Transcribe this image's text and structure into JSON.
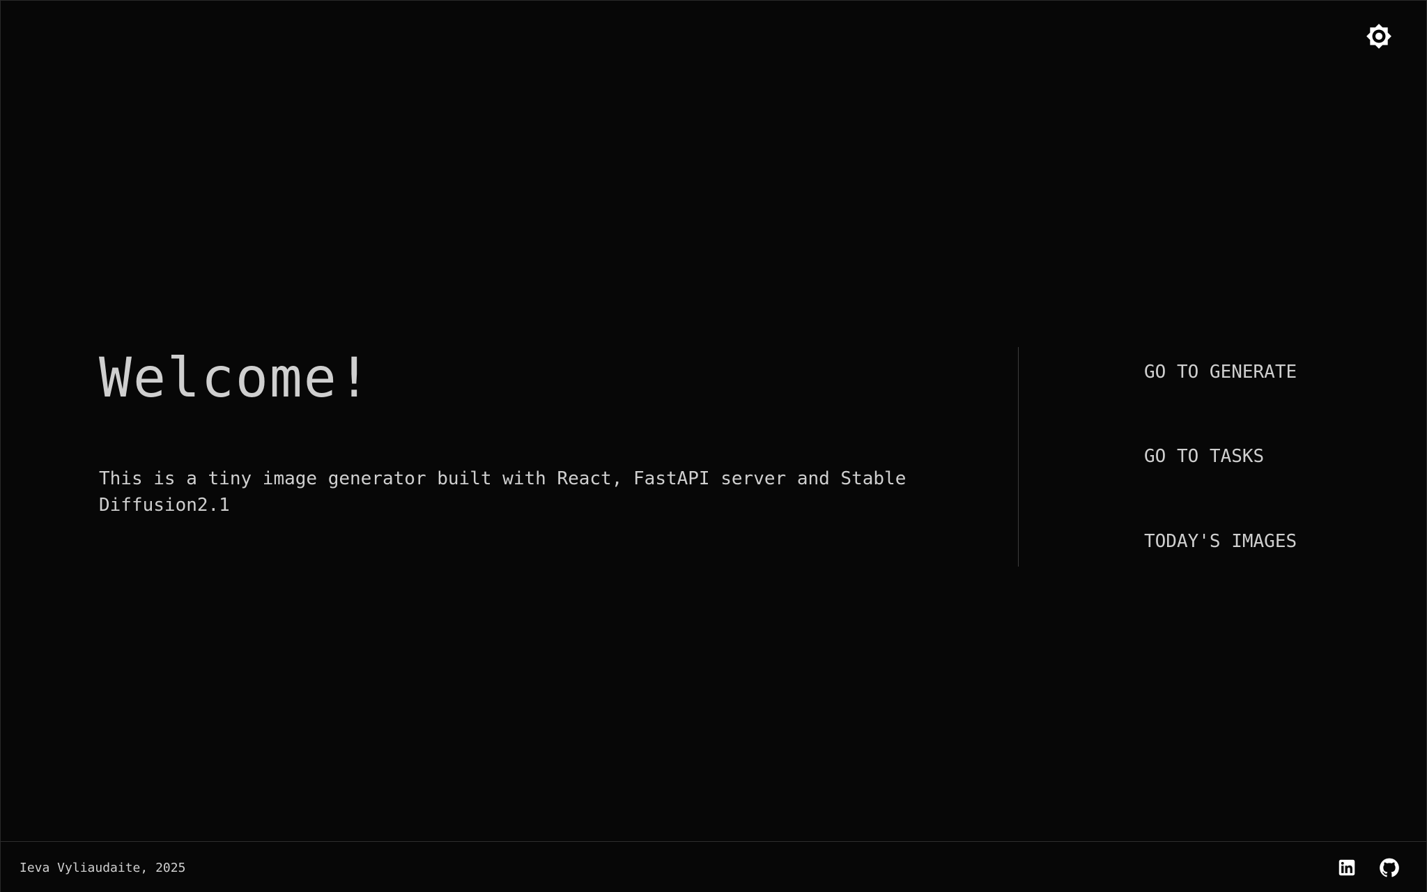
{
  "header": {
    "theme_toggle_icon": "sun-brightness-icon"
  },
  "main": {
    "title": "Welcome!",
    "intro": "This is a tiny image generator built with React, FastAPI server and Stable Diffusion2.1"
  },
  "nav": {
    "items": [
      {
        "label": "GO TO GENERATE"
      },
      {
        "label": "GO TO TASKS"
      },
      {
        "label": "TODAY'S IMAGES"
      }
    ]
  },
  "footer": {
    "credit": "Ieva Vyliaudaite, 2025",
    "social": [
      {
        "icon": "linkedin-icon"
      },
      {
        "icon": "github-icon"
      }
    ]
  },
  "colors": {
    "background": "#070707",
    "text": "#cfcfcf",
    "divider": "#3c3c3c",
    "icon": "#ffffff"
  }
}
